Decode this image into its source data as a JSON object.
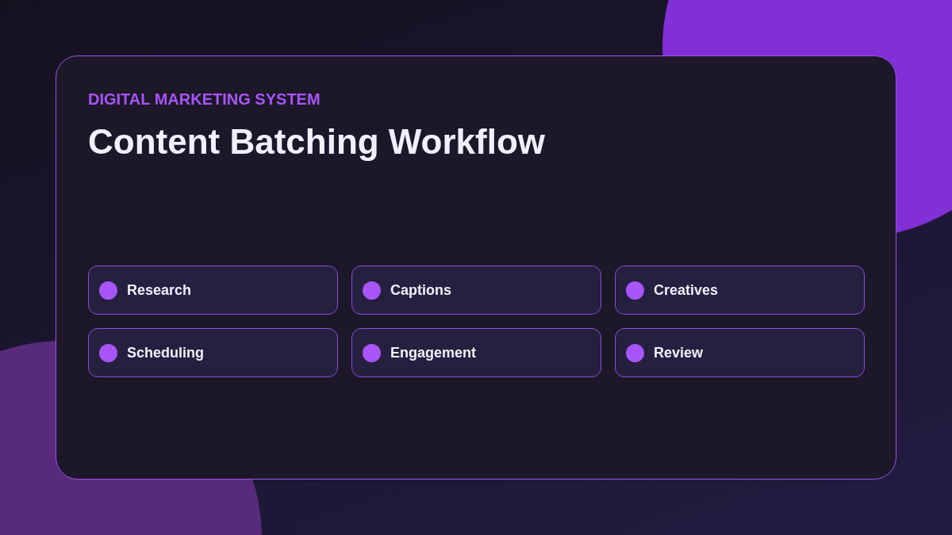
{
  "eyebrow": "DIGITAL MARKETING SYSTEM",
  "title": "Content Batching Workflow",
  "steps": [
    {
      "label": "Research",
      "color": "#a855f7"
    },
    {
      "label": "Captions",
      "color": "#a855f7"
    },
    {
      "label": "Creatives",
      "color": "#a855f7"
    },
    {
      "label": "Scheduling",
      "color": "#a855f7"
    },
    {
      "label": "Engagement",
      "color": "#a855f7"
    },
    {
      "label": "Review",
      "color": "#a855f7"
    }
  ]
}
